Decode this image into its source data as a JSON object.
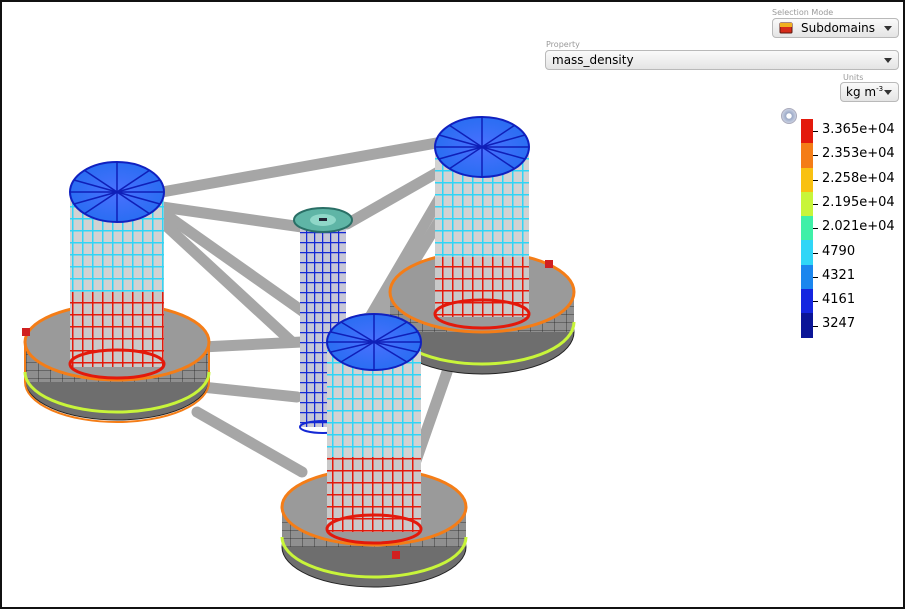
{
  "selection_mode": {
    "caption": "Selection Mode",
    "value": "Subdomains",
    "icon": "subdomain-cube-icon"
  },
  "property": {
    "caption": "Property",
    "value": "mass_density"
  },
  "units": {
    "caption": "Units",
    "base": "kg m",
    "exponent": "-3"
  },
  "legend": {
    "icon": "legend-settings-icon",
    "entries": [
      {
        "label": "3.365e+04",
        "color": "#e31a0c"
      },
      {
        "label": "2.353e+04",
        "color": "#f47d17"
      },
      {
        "label": "2.258e+04",
        "color": "#f9c111"
      },
      {
        "label": "2.195e+04",
        "color": "#c8f53a"
      },
      {
        "label": "2.021e+04",
        "color": "#3ff0a8"
      },
      {
        "label": "4790",
        "color": "#30d6f7"
      },
      {
        "label": "4321",
        "color": "#1b86ee"
      },
      {
        "label": "4161",
        "color": "#1526e0"
      },
      {
        "label": "3247",
        "color": "#0b1597"
      }
    ]
  },
  "colors": {
    "brace": "#a8a8a8",
    "heave_plate": "#6f6f6f",
    "column_upper": "#30d6f7",
    "column_lower": "#e31a0c",
    "center_column": "#1526e0",
    "top_cap": "#1b3ae0"
  }
}
